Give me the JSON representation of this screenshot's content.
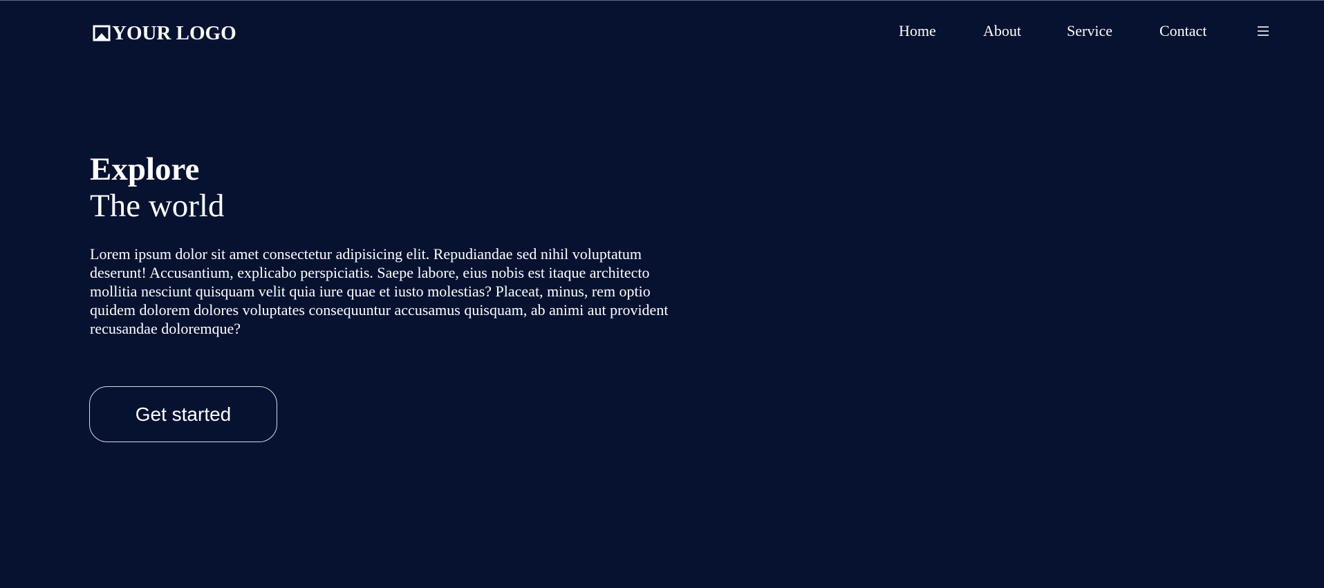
{
  "colors": {
    "background": "#071230",
    "text": "#ffffff",
    "button_border": "#d7dbe4"
  },
  "header": {
    "logo": {
      "icon": "image-logo-icon",
      "text": "YOUR LOGO"
    },
    "nav": {
      "items": [
        {
          "label": "Home"
        },
        {
          "label": "About"
        },
        {
          "label": "Service"
        },
        {
          "label": "Contact"
        }
      ],
      "menu_icon": "hamburger-menu-icon"
    }
  },
  "hero": {
    "title": "Explore",
    "subtitle": "The world",
    "paragraph": "Lorem ipsum dolor sit amet consectetur adipisicing elit. Repudiandae sed nihil voluptatum deserunt! Accusantium, explicabo perspiciatis. Saepe labore, eius nobis est itaque architecto mollitia nesciunt quisquam velit quia iure quae et iusto molestias? Placeat, minus, rem optio quidem dolorem dolores voluptates consequuntur accusamus quisquam, ab animi aut provident recusandae doloremque?",
    "cta_label": "Get started"
  }
}
